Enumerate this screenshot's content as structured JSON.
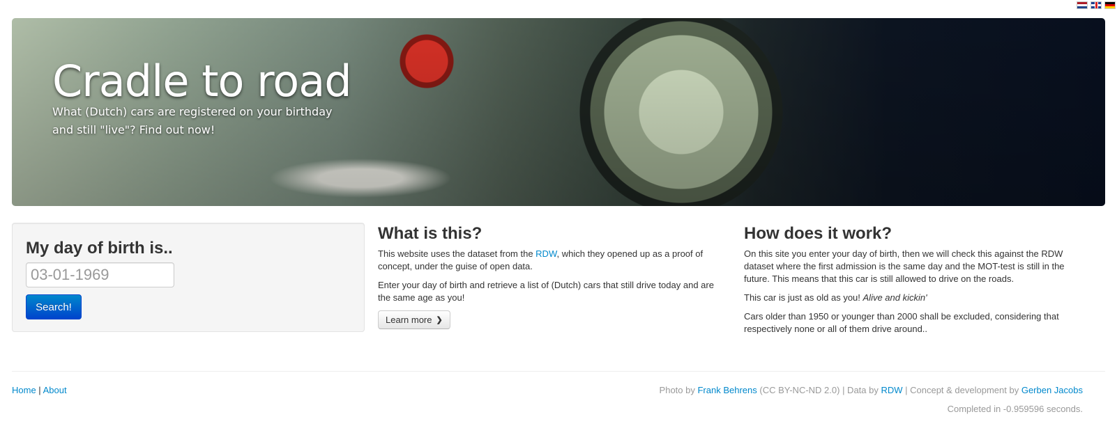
{
  "flags": [
    "flag-nl-icon",
    "flag-uk-icon",
    "flag-de-icon"
  ],
  "hero": {
    "title": "Cradle to road",
    "subtitle": "What (Dutch) cars are registered on your birthday and still \"live\"? Find out now!"
  },
  "form": {
    "heading": "My day of birth is..",
    "placeholder": "03-01-1969",
    "button": "Search!"
  },
  "what": {
    "heading": "What is this?",
    "p1_before": "This website uses the dataset from the ",
    "p1_link": "RDW",
    "p1_after": ", which they opened up as a proof of concept, under the guise of open data.",
    "p2": "Enter your day of birth and retrieve a list of (Dutch) cars that still drive today and are the same age as you!",
    "button": "Learn more"
  },
  "how": {
    "heading": "How does it work?",
    "p1": "On this site you enter your day of birth, then we will check this against the RDW dataset where the first admission is the same day and the MOT-test is still in the future. This means that this car is still allowed to drive on the roads.",
    "p2_text": "This car is just as old as you! ",
    "p2_em": "Alive and kickin'",
    "p3": "Cars older than 1950 or younger than 2000 shall be excluded, considering that respectively none or all of them drive around.."
  },
  "footer": {
    "home": "Home",
    "separator": " | ",
    "about": "About",
    "photo_by": "Photo by ",
    "photographer": "Frank Behrens",
    "license": " (CC BY-NC-ND 2.0) | Data by ",
    "data_source": "RDW",
    "concept": " | Concept & development by ",
    "developer": "Gerben Jacobs",
    "completed": "Completed in -0.959596 seconds."
  },
  "colors": {
    "link": "#0088cc",
    "primary_button": "#0066cc",
    "muted_text": "#999999"
  }
}
